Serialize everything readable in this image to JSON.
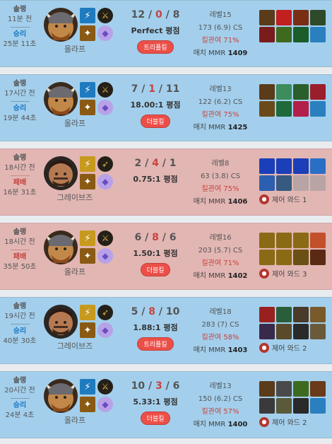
{
  "matches": [
    {
      "result": "win",
      "queue": "솔랭",
      "ago": "11분 전",
      "result_label": "승리",
      "duration": "25분 11초",
      "champion": "올라프",
      "portrait": "olaf",
      "spells": [
        {
          "name": "flash-icon",
          "color": "#1f7bbf",
          "glyph": "⚡"
        },
        {
          "name": "smite-icon",
          "color": "#8a5a14",
          "glyph": "✦"
        }
      ],
      "runes": [
        {
          "name": "conqueror-rune-icon",
          "color": "#242018",
          "glyph": "⚔",
          "fg": "#e3b24a"
        },
        {
          "name": "sorcery-rune-icon",
          "color": "#b7a2e8",
          "glyph": "◆",
          "fg": "#6b4bc4"
        }
      ],
      "kills": "12",
      "deaths": "0",
      "assists": "8",
      "ratio": "Perfect 평점",
      "badge": "트리플킬",
      "level": "레벨15",
      "cs": "173 (6.9) CS",
      "kp": "킬관여 71%",
      "mmr_label": "매치 MMR",
      "mmr": "1409",
      "items": [
        {
          "n": "item-icon",
          "c": "#5a3b1a"
        },
        {
          "n": "item-icon",
          "c": "#c21f1f"
        },
        {
          "n": "item-icon",
          "c": "#7a2e14"
        },
        {
          "n": "item-icon",
          "c": "#2f4a2a"
        },
        {
          "n": "item-icon",
          "c": "#7b1c1c"
        },
        {
          "n": "item-icon",
          "c": "#3e6a1f"
        },
        {
          "n": "item-icon",
          "c": "#1a5c2a"
        },
        {
          "n": "item-icon",
          "c": "#2a7fbf"
        }
      ],
      "ward": ""
    },
    {
      "result": "win",
      "queue": "솔랭",
      "ago": "17시간 전",
      "result_label": "승리",
      "duration": "19분 44초",
      "champion": "올라프",
      "portrait": "olaf",
      "spells": [
        {
          "name": "flash-icon",
          "color": "#1f7bbf",
          "glyph": "⚡"
        },
        {
          "name": "smite-icon",
          "color": "#8a5a14",
          "glyph": "✦"
        }
      ],
      "runes": [
        {
          "name": "conqueror-rune-icon",
          "color": "#242018",
          "glyph": "⚔",
          "fg": "#e3b24a"
        },
        {
          "name": "sorcery-rune-icon",
          "color": "#b7a2e8",
          "glyph": "◆",
          "fg": "#6b4bc4"
        }
      ],
      "kills": "7",
      "deaths": "1",
      "assists": "11",
      "ratio": "18.00:1 평점",
      "badge": "더블킬",
      "level": "레벨13",
      "cs": "122 (6.2) CS",
      "kp": "킬관여 75%",
      "mmr_label": "매치 MMR",
      "mmr": "1425",
      "items": [
        {
          "n": "item-icon",
          "c": "#5a3b1a"
        },
        {
          "n": "item-icon",
          "c": "#3d8c5c"
        },
        {
          "n": "item-icon",
          "c": "#2a5e2a"
        },
        {
          "n": "item-icon",
          "c": "#9a1f2a"
        },
        {
          "n": "item-icon",
          "c": "#6b4a1a"
        },
        {
          "n": "item-icon",
          "c": "#1e6a3a"
        },
        {
          "n": "item-icon",
          "c": "#b2204a"
        },
        {
          "n": "item-icon",
          "c": "#2a7fbf"
        }
      ],
      "ward": ""
    },
    {
      "result": "loss",
      "queue": "솔랭",
      "ago": "18시간 전",
      "result_label": "패배",
      "duration": "16분 31초",
      "champion": "그레이브즈",
      "portrait": "graves",
      "spells": [
        {
          "name": "flash-icon",
          "color": "#c79a1e",
          "glyph": "⚡"
        },
        {
          "name": "smite-icon",
          "color": "#8a5a14",
          "glyph": "✦"
        }
      ],
      "runes": [
        {
          "name": "fleet-rune-icon",
          "color": "#242018",
          "glyph": "➶",
          "fg": "#e3b24a"
        },
        {
          "name": "sorcery-rune-icon",
          "color": "#b7a2e8",
          "glyph": "◆",
          "fg": "#6b4bc4"
        }
      ],
      "kills": "2",
      "deaths": "4",
      "assists": "1",
      "ratio": "0.75:1 평점",
      "badge": "",
      "level": "레벨8",
      "cs": "63 (3.8) CS",
      "kp": "킬관여 75%",
      "mmr_label": "매치 MMR",
      "mmr": "1406",
      "items": [
        {
          "n": "item-icon",
          "c": "#1b3fb8"
        },
        {
          "n": "item-icon",
          "c": "#1b3fb8"
        },
        {
          "n": "item-icon",
          "c": "#1b3fb8"
        },
        {
          "n": "item-icon",
          "c": "#2a6fc6"
        },
        {
          "n": "item-icon",
          "c": "#2d5fb0"
        },
        {
          "n": "item-icon",
          "c": "#365a80"
        },
        {
          "n": "item-icon",
          "c": "#b8a4a4"
        },
        {
          "n": "item-icon",
          "c": "#b8a4a4"
        }
      ],
      "ward": "제어 와드 1"
    },
    {
      "result": "loss",
      "queue": "솔랭",
      "ago": "18시간 전",
      "result_label": "패배",
      "duration": "35분 50초",
      "champion": "올라프",
      "portrait": "olaf",
      "spells": [
        {
          "name": "flash-icon",
          "color": "#c79a1e",
          "glyph": "⚡"
        },
        {
          "name": "smite-icon",
          "color": "#8a5a14",
          "glyph": "✦"
        }
      ],
      "runes": [
        {
          "name": "conqueror-rune-icon",
          "color": "#242018",
          "glyph": "⚔",
          "fg": "#e3b24a"
        },
        {
          "name": "sorcery-rune-icon",
          "color": "#b7a2e8",
          "glyph": "◆",
          "fg": "#6b4bc4"
        }
      ],
      "kills": "6",
      "deaths": "8",
      "assists": "6",
      "ratio": "1.50:1 평점",
      "badge": "더블킬",
      "level": "레벨16",
      "cs": "203 (5.7) CS",
      "kp": "킬관여 71%",
      "mmr_label": "매치 MMR",
      "mmr": "1402",
      "items": [
        {
          "n": "item-icon",
          "c": "#8a6a14"
        },
        {
          "n": "item-icon",
          "c": "#8a6a14"
        },
        {
          "n": "item-icon",
          "c": "#8a6a14"
        },
        {
          "n": "item-icon",
          "c": "#c2502a"
        },
        {
          "n": "item-icon",
          "c": "#8a6a14"
        },
        {
          "n": "item-icon",
          "c": "#8a6a14"
        },
        {
          "n": "item-icon",
          "c": "#6a5014"
        },
        {
          "n": "item-icon",
          "c": "#5a2a14"
        }
      ],
      "ward": "제어 와드 3"
    },
    {
      "result": "win",
      "queue": "솔랭",
      "ago": "19시간 전",
      "result_label": "승리",
      "duration": "40분 30초",
      "champion": "그레이브즈",
      "portrait": "graves",
      "spells": [
        {
          "name": "flash-icon",
          "color": "#c79a1e",
          "glyph": "⚡"
        },
        {
          "name": "smite-icon",
          "color": "#8a5a14",
          "glyph": "✦"
        }
      ],
      "runes": [
        {
          "name": "fleet-rune-icon",
          "color": "#242018",
          "glyph": "➶",
          "fg": "#e3b24a"
        },
        {
          "name": "sorcery-rune-icon",
          "color": "#b7a2e8",
          "glyph": "◆",
          "fg": "#6b4bc4"
        }
      ],
      "kills": "5",
      "deaths": "8",
      "assists": "10",
      "ratio": "1.88:1 평점",
      "badge": "트리플킬",
      "level": "레벨18",
      "cs": "283 (7) CS",
      "kp": "킬관여 58%",
      "mmr_label": "매치 MMR",
      "mmr": "1403",
      "items": [
        {
          "n": "item-icon",
          "c": "#9a1f1f"
        },
        {
          "n": "item-icon",
          "c": "#2a5e3a"
        },
        {
          "n": "item-icon",
          "c": "#4a3a2a"
        },
        {
          "n": "item-icon",
          "c": "#7a5a2a"
        },
        {
          "n": "item-icon",
          "c": "#3a2a4a"
        },
        {
          "n": "item-icon",
          "c": "#5a4a2a"
        },
        {
          "n": "item-icon",
          "c": "#2a2a2a"
        },
        {
          "n": "item-icon",
          "c": "#6a5a3a"
        }
      ],
      "ward": "제어 와드 2"
    },
    {
      "result": "win",
      "queue": "솔랭",
      "ago": "20시간 전",
      "result_label": "승리",
      "duration": "24분 4초",
      "champion": "올라프",
      "portrait": "olaf",
      "spells": [
        {
          "name": "flash-icon",
          "color": "#1f7bbf",
          "glyph": "⚡"
        },
        {
          "name": "smite-icon",
          "color": "#8a5a14",
          "glyph": "✦"
        }
      ],
      "runes": [
        {
          "name": "conqueror-rune-icon",
          "color": "#242018",
          "glyph": "⚔",
          "fg": "#e3b24a"
        },
        {
          "name": "sorcery-rune-icon",
          "color": "#b7a2e8",
          "glyph": "◆",
          "fg": "#6b4bc4"
        }
      ],
      "kills": "10",
      "deaths": "3",
      "assists": "6",
      "ratio": "5.33:1 평점",
      "badge": "더블킬",
      "level": "레벨13",
      "cs": "150 (6.2) CS",
      "kp": "킬관여 57%",
      "mmr_label": "매치 MMR",
      "mmr": "1400",
      "items": [
        {
          "n": "item-icon",
          "c": "#5a3b1a"
        },
        {
          "n": "item-icon",
          "c": "#4a4a4a"
        },
        {
          "n": "item-icon",
          "c": "#3e6a1f"
        },
        {
          "n": "item-icon",
          "c": "#6a3a1a"
        },
        {
          "n": "item-icon",
          "c": "#3a3a3a"
        },
        {
          "n": "item-icon",
          "c": "#5a5a3a"
        },
        {
          "n": "item-icon",
          "c": "#2a2a2a"
        },
        {
          "n": "item-icon",
          "c": "#2a7fbf"
        }
      ],
      "ward": "제어 와드 2"
    }
  ]
}
